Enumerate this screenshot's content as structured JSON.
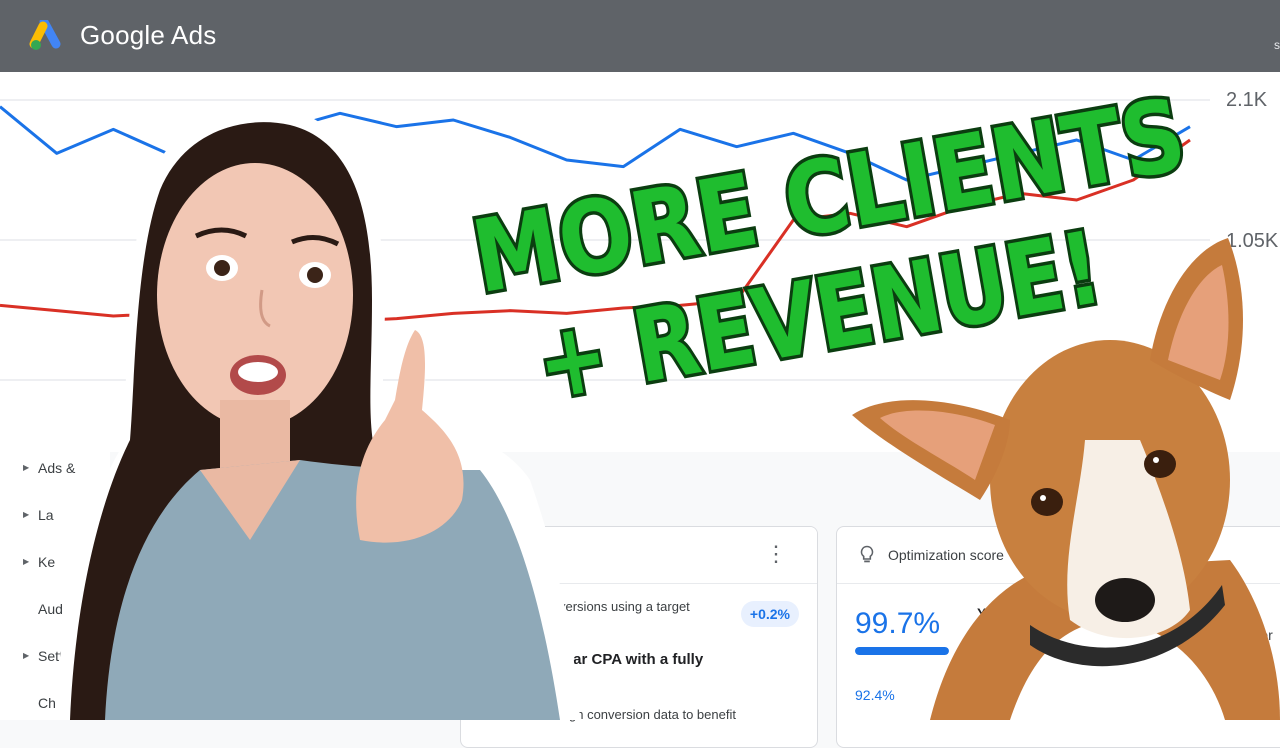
{
  "app": {
    "brand_google": "Google",
    "brand_ads": "Ads",
    "topbar_fragment": "s"
  },
  "chart_data": {
    "type": "line",
    "y_ticks": [
      "2.1K",
      "1.05K"
    ],
    "grid": true,
    "series": [
      {
        "color": "#1a73e8",
        "values": [
          2050,
          1700,
          1880,
          1690,
          1950,
          1880,
          2000,
          1900,
          1950,
          1820,
          1650,
          1600,
          1880,
          1750,
          1850,
          1700,
          1500,
          1600,
          1700,
          1800,
          1650,
          1900
        ]
      },
      {
        "color": "#d93025",
        "values": [
          560,
          520,
          480,
          500,
          470,
          450,
          440,
          460,
          500,
          520,
          500,
          540,
          560,
          600,
          1200,
          1250,
          1150,
          1300,
          1400,
          1350,
          1500,
          1800
        ]
      }
    ],
    "colors": {
      "blue": "#1a73e8",
      "red": "#d93025",
      "grid": "#e8eaed"
    }
  },
  "nav": {
    "items": [
      {
        "label": "Ads &",
        "has_caret": true
      },
      {
        "label": "La",
        "has_caret": true
      },
      {
        "label": "Ke",
        "has_caret": true
      },
      {
        "label": "Aud",
        "has_caret": false
      },
      {
        "label": "Setti",
        "has_caret": true
      },
      {
        "label": "Change",
        "has_caret": false
      }
    ]
  },
  "recommendation_card": {
    "line1": "versions using a target",
    "uplift": "+0.2%",
    "line2": "lar CPA with a fully",
    "line3": "gh conversion data to benefit",
    "more_icon": "more-vert-icon"
  },
  "optimization_card": {
    "title": "Optimization score",
    "score": "99.7%",
    "score_fill": 0.997,
    "sub_score": "92.4%",
    "fragment_bold": "Y",
    "fragment_right": "mmer",
    "icon": "lightbulb-icon"
  },
  "headline": {
    "line1": "MORE CLIENTS",
    "line2": "+ REVENUE!",
    "fill": "#1fbd2f",
    "stroke": "#0b3d10"
  }
}
